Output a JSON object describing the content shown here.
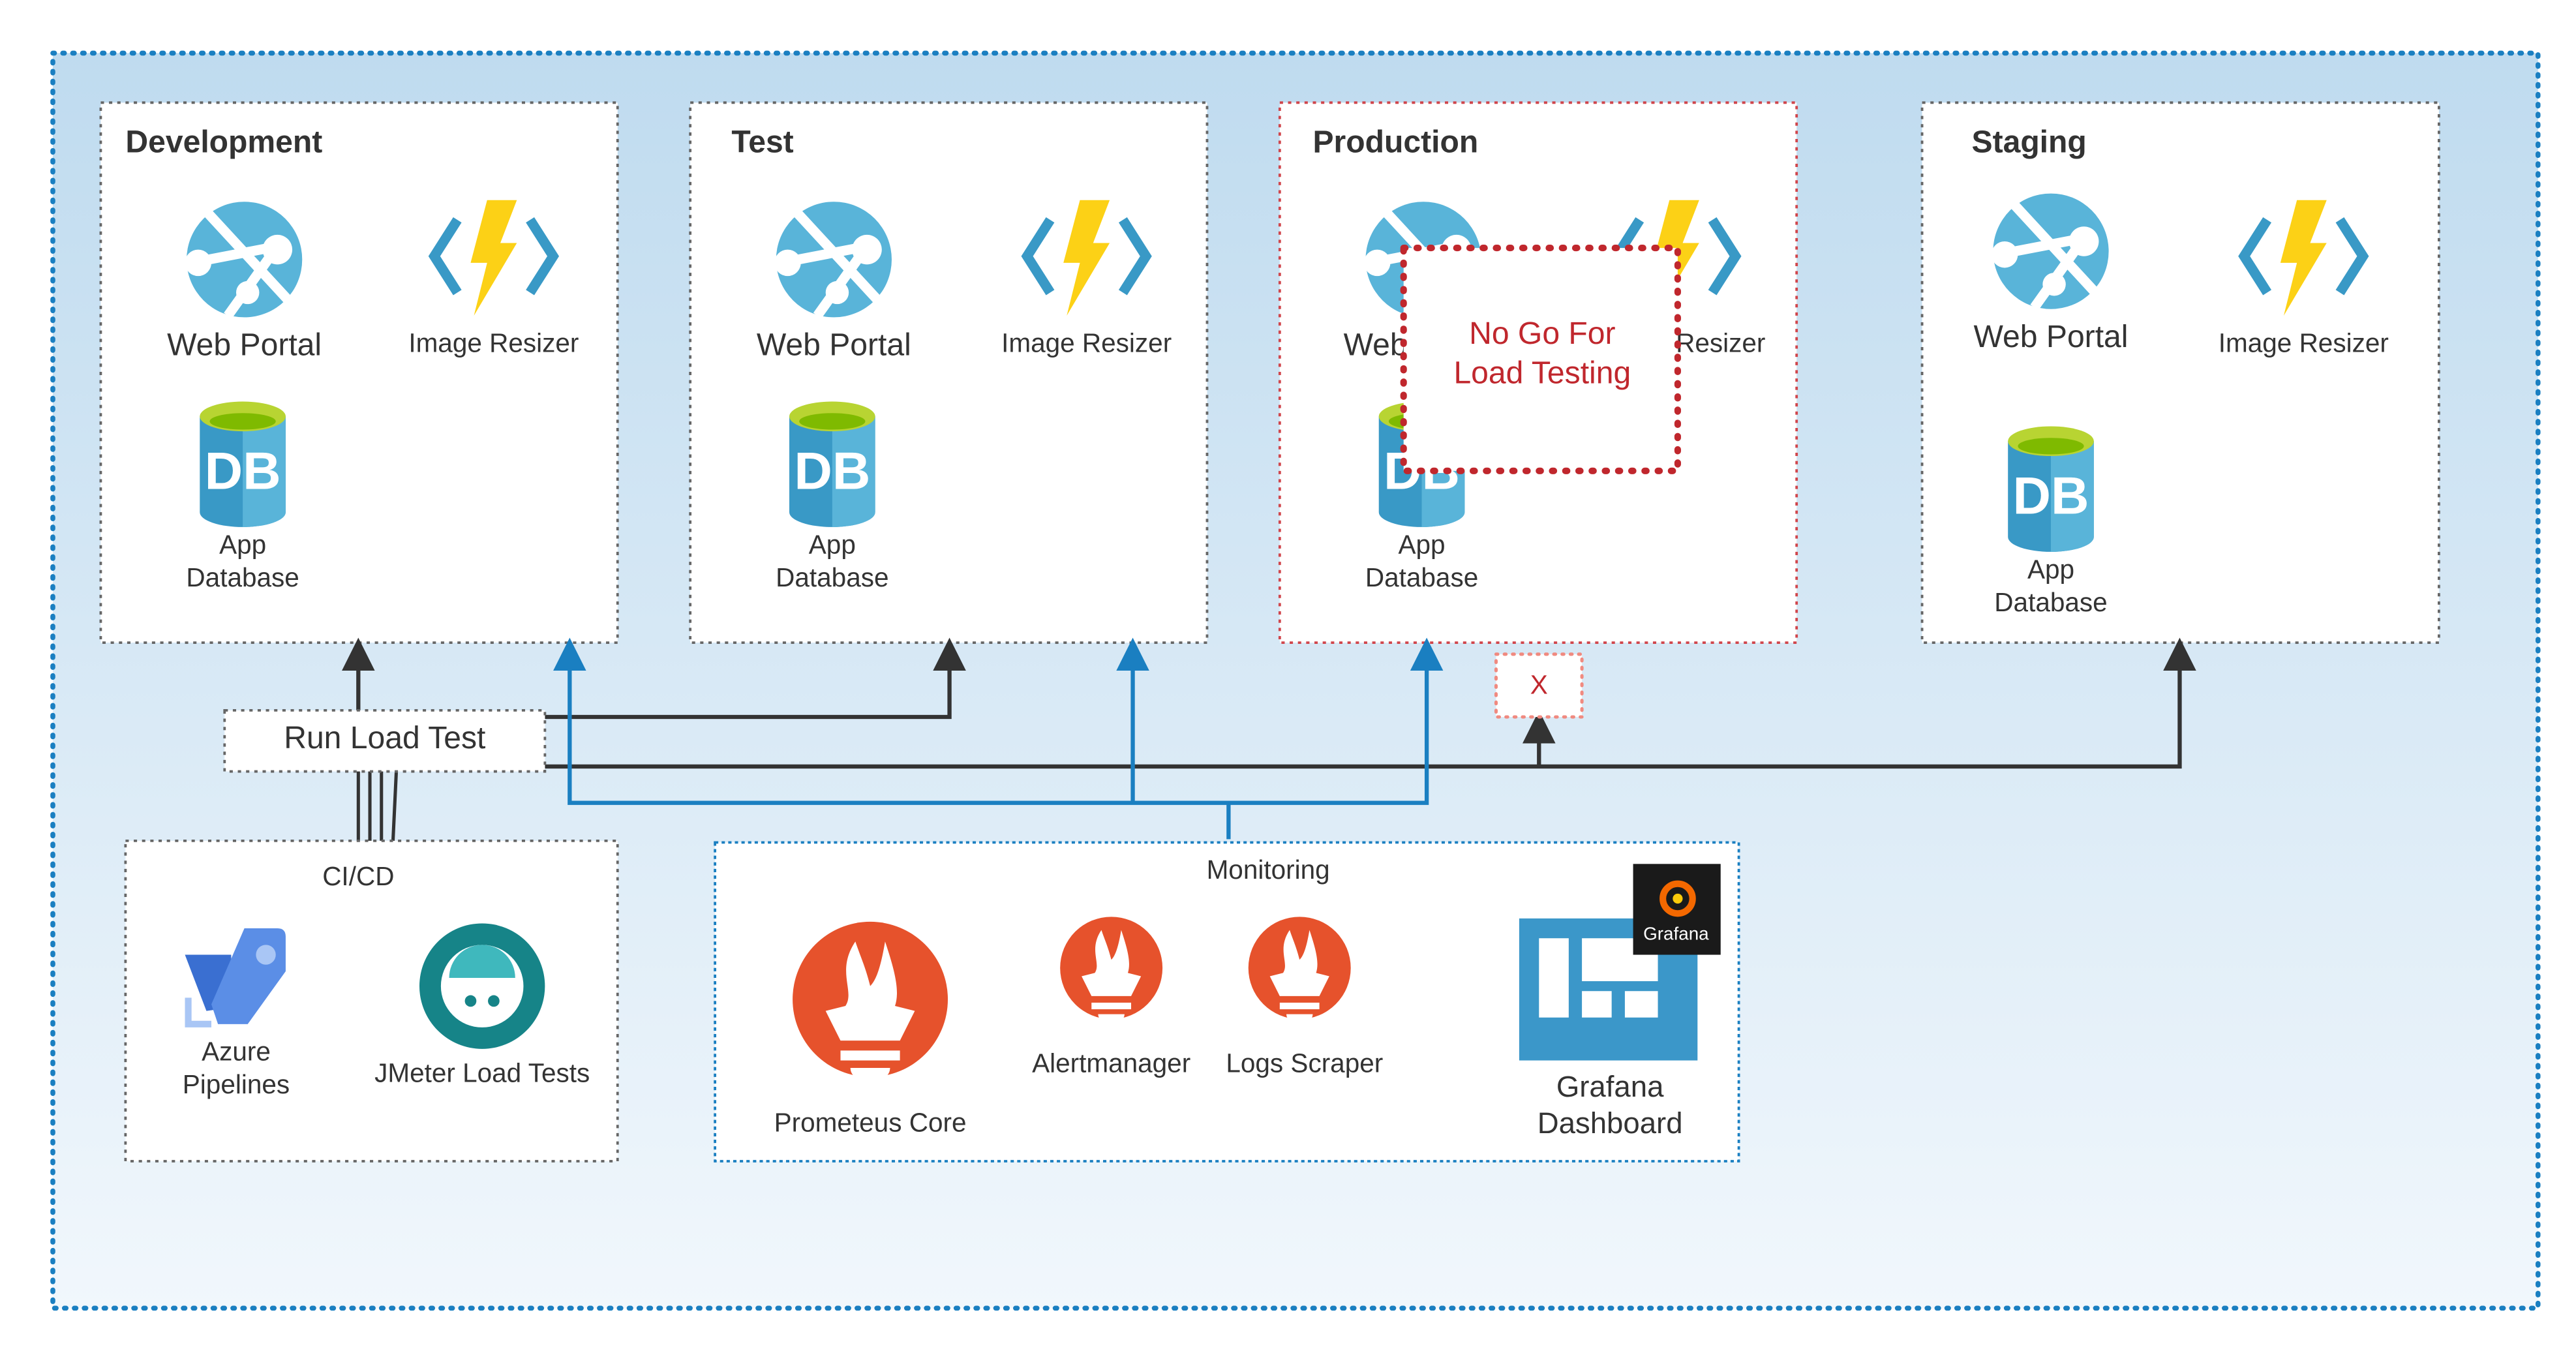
{
  "colors": {
    "frame": "#1a7fc1",
    "link": "#1a7fc1",
    "arrow": "#333333",
    "danger": "#c0272d",
    "prometheus": "#e6522c",
    "azure": "#59b4d9",
    "function": "#fcd116",
    "db_top": "#b8d432",
    "jmeter": "#168488",
    "grafana_tile": "#3b97c9"
  },
  "environments": [
    {
      "title": "Development",
      "web": "Web Portal",
      "resizer": "Image Resizer",
      "db1": "App",
      "db2": "Database"
    },
    {
      "title": "Test",
      "web": "Web Portal",
      "resizer": "Image Resizer",
      "db1": "App",
      "db2": "Database"
    },
    {
      "title": "Production",
      "web": "Web",
      "resizer": "Resizer",
      "db1": "App",
      "db2": "Database"
    },
    {
      "title": "Staging",
      "web": "Web Portal",
      "resizer": "Image Resizer",
      "db1": "App",
      "db2": "Database"
    }
  ],
  "production_block": {
    "line1": "No Go For",
    "line2": "Load Testing",
    "blocked": "X"
  },
  "run_load_test": "Run Load Test",
  "cicd": {
    "title": "CI/CD",
    "azure1": "Azure",
    "azure2": "Pipelines",
    "jmeter": "JMeter Load Tests"
  },
  "monitoring": {
    "title": "Monitoring",
    "prometheus": "Prometeus Core",
    "alertmanager": "Alertmanager",
    "logs": "Logs Scraper",
    "grafana1": "Grafana",
    "grafana2": "Dashboard",
    "grafana_logo": "Grafana"
  }
}
